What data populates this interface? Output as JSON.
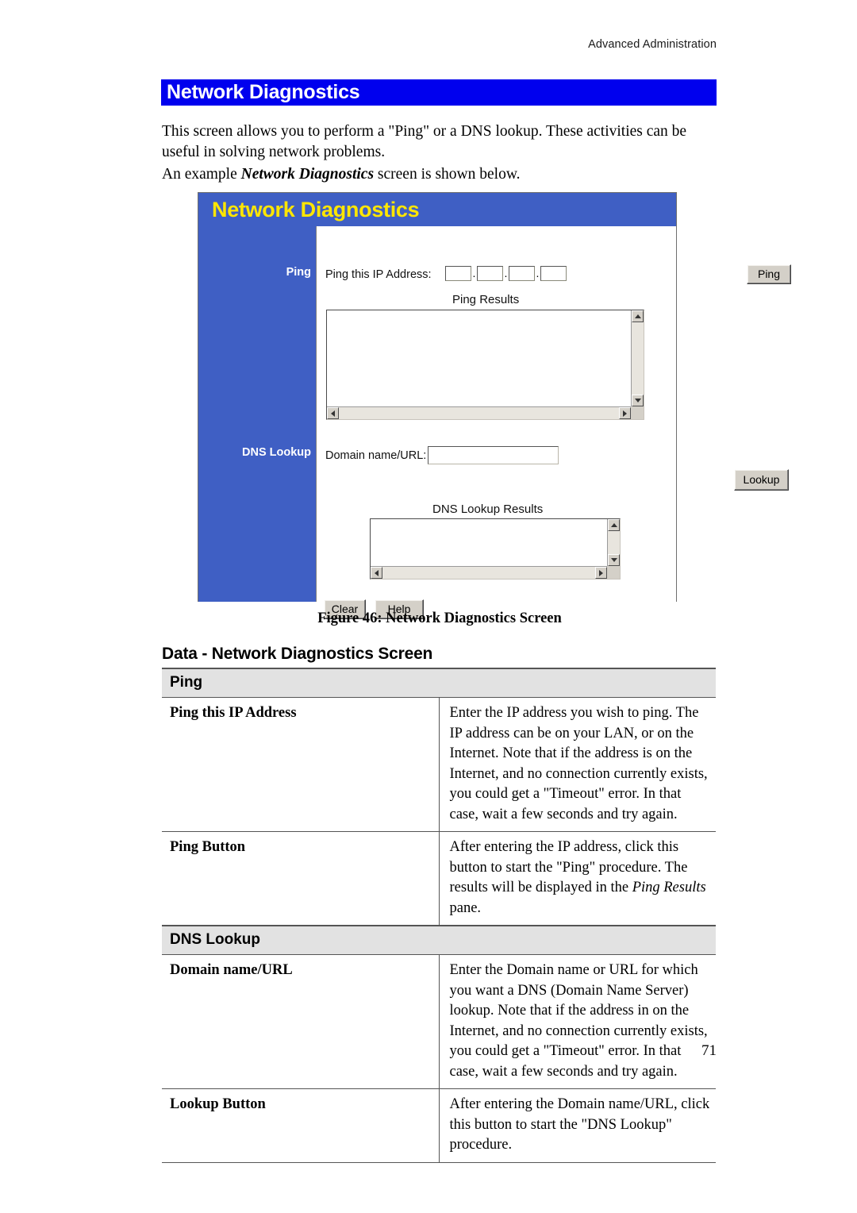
{
  "header": {
    "running_head": "Advanced Administration"
  },
  "title_bar": {
    "text": "Network Diagnostics",
    "bg_color": "#0000ee",
    "text_color": "#ffffff"
  },
  "intro": {
    "para1_part1": "This screen allows you to perform a \"Ping\" or a DNS lookup. These activities can be useful in solving network problems.",
    "para2_part1": "An example ",
    "para2_emph": "Network Diagnostics",
    "para2_part2": " screen is shown below."
  },
  "figure": {
    "caption": "Figure 46: Network Diagnostics Screen",
    "panel_bg_color": "#3f5fc4",
    "panel_title_color": "#ffe600",
    "panel_title": "Network Diagnostics",
    "sidebar": {
      "ping_label": "Ping",
      "dns_label": "DNS Lookup"
    },
    "ping_section": {
      "ip_label": "Ping this IP Address:",
      "octet1": "",
      "octet2": "",
      "octet3": "",
      "octet4": "",
      "separator": ".",
      "ping_button": "Ping",
      "results_caption": "Ping Results",
      "results_value": ""
    },
    "dns_section": {
      "domain_label": "Domain name/URL:",
      "domain_value": "",
      "lookup_button": "Lookup",
      "results_caption": "DNS Lookup Results",
      "results_value": ""
    },
    "footer_buttons": {
      "clear": "Clear",
      "help": "Help"
    }
  },
  "data_section": {
    "heading": "Data - Network Diagnostics Screen",
    "sections": [
      {
        "title": "Ping",
        "rows": [
          {
            "name": "Ping this IP Address",
            "desc": "Enter the IP address you wish to ping. The IP address can be on your LAN, or on the Internet. Note that if the address is on the Internet, and no connection currently exists, you could get a \"Timeout\" error. In that case, wait a few seconds and try again."
          },
          {
            "name": "Ping Button",
            "desc_pre": "After entering the IP address, click this button to start the \"Ping\" procedure.  The results will be displayed in the ",
            "desc_emph": "Ping Results",
            "desc_post": " pane."
          }
        ]
      },
      {
        "title": "DNS Lookup",
        "rows": [
          {
            "name": "Domain name/URL",
            "desc": "Enter the Domain name or URL for which you want a DNS (Domain Name Server) lookup. Note that if the address in on the Internet, and no connection currently exists, you could get a \"Timeout\" error. In that case, wait a few seconds and try again."
          },
          {
            "name": "Lookup Button",
            "desc": "After entering the Domain name/URL, click this button to start the \"DNS Lookup\" procedure."
          }
        ]
      }
    ]
  },
  "footer": {
    "page_number": "71"
  }
}
